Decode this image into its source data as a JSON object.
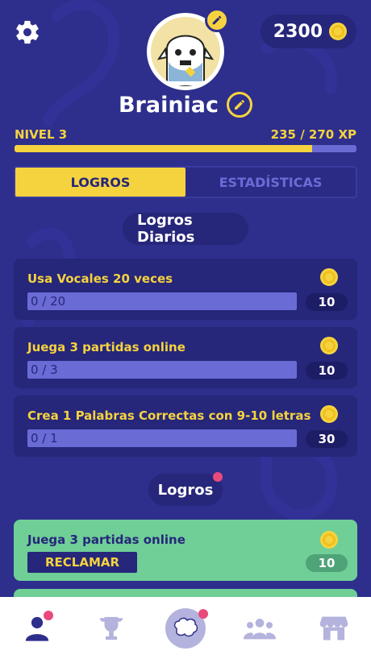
{
  "header": {
    "coins": "2300",
    "username": "Brainiac"
  },
  "level": {
    "label": "NIVEL 3",
    "xp_text": "235 / 270 XP",
    "progress": 0.87
  },
  "tabs": [
    {
      "label": "LOGROS",
      "active": true
    },
    {
      "label": "ESTADÍSTICAS",
      "active": false
    }
  ],
  "daily": {
    "title": "Logros Diarios",
    "items": [
      {
        "title": "Usa Vocales 20 veces",
        "progress": "0 / 20",
        "reward": "10"
      },
      {
        "title": "Juega 3 partidas online",
        "progress": "0 / 3",
        "reward": "10"
      },
      {
        "title": "Crea 1 Palabras Correctas con 9-10 letras",
        "progress": "0 / 1",
        "reward": "30"
      }
    ]
  },
  "achievements": {
    "title": "Logros",
    "items": [
      {
        "title": "Juega 3 partidas online",
        "button": "RECLAMAR",
        "reward": "10"
      }
    ]
  },
  "colors": {
    "background": "#2e2e8c",
    "accent": "#f5d33f",
    "card": "#26267a",
    "progress": "#6b6bd6",
    "claim_card": "#6fcf97",
    "notification": "#e84a7a"
  },
  "nav": [
    "profile-icon",
    "trophy-icon",
    "brain-icon",
    "friends-icon",
    "shop-icon"
  ]
}
